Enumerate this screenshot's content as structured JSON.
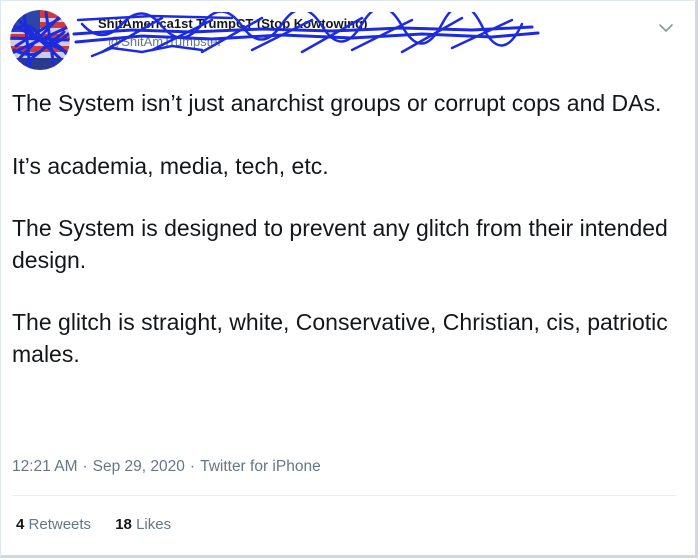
{
  "header": {
    "display_name": "ShitAmerica1st TrumpCT (Stop Kowtowing)",
    "handle": "@ShitAmTrumpster",
    "menu_icon": "chevron-down-icon"
  },
  "tweet": {
    "paragraphs": [
      "The System isn’t just anarchist groups or corrupt cops and DAs.",
      "It’s academia, media, tech, etc.",
      "The System is designed to prevent any glitch from their intended design.",
      "The glitch is straight, white, Conservative, Christian, cis, patriotic males."
    ],
    "time": "12:21 AM",
    "date": "Sep 29, 2020",
    "source": "Twitter for iPhone",
    "separator": "·"
  },
  "stats": {
    "retweets_count": "4",
    "retweets_label": "Retweets",
    "likes_count": "18",
    "likes_label": "Likes"
  },
  "colors": {
    "text": "#14171a",
    "muted": "#657786",
    "scribble": "#1d2be0"
  }
}
